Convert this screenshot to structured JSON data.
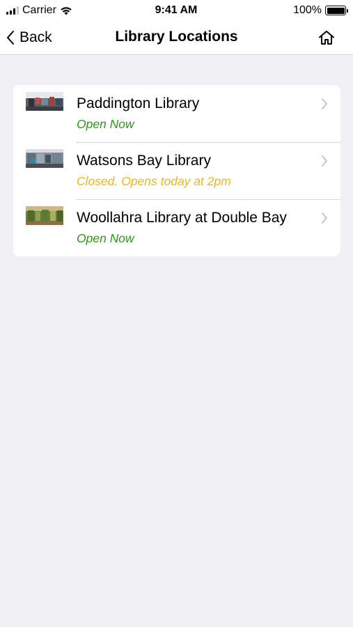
{
  "status_bar": {
    "carrier": "Carrier",
    "time": "9:41 AM",
    "battery": "100%",
    "icons": [
      "signal-icon",
      "wifi-icon",
      "battery-icon"
    ]
  },
  "nav": {
    "back_label": "Back",
    "title": "Library Locations",
    "icons": [
      "chevron-left-icon",
      "home-icon"
    ]
  },
  "libraries": [
    {
      "name": "Paddington Library",
      "status": "Open Now",
      "state": "open"
    },
    {
      "name": "Watsons Bay Library",
      "status": "Closed. Opens today at 2pm",
      "state": "closed"
    },
    {
      "name": "Woollahra Library at Double Bay",
      "status": "Open Now",
      "state": "open"
    }
  ],
  "colors": {
    "open": "#2a9a15",
    "closed": "#f0b41c",
    "background": "#efeff4",
    "separator": "#d6d6da",
    "chevron": "#c4c4c9"
  }
}
